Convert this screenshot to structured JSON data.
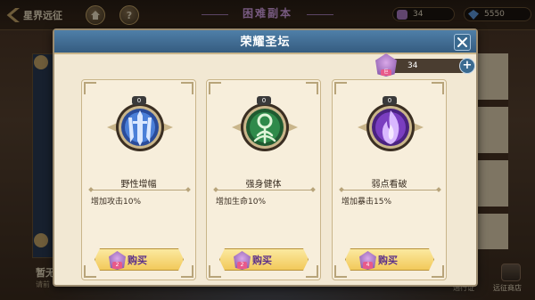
{
  "topbar": {
    "back_label": "星界远征",
    "home_icon": "home-icon",
    "help_label": "?",
    "stage_title": "困难副本",
    "resource_a": "34",
    "resource_b": "5550"
  },
  "background": {
    "bottom_left_title": "暂无",
    "bottom_left_sub": "请前",
    "bottom_mid_label": "通行证",
    "shop_label": "远征商店"
  },
  "modal": {
    "title": "荣耀圣坛",
    "currency_amount": "34",
    "currency_badge": "巨",
    "plus_label": "+"
  },
  "cards": [
    {
      "name": "野性增幅",
      "desc": "增加攻击10%",
      "level": "0",
      "cost": "2",
      "buy_label": "购买",
      "icon": "sword-emblem-icon",
      "accent": "#4a7fd8"
    },
    {
      "name": "强身健体",
      "desc": "增加生命10%",
      "level": "0",
      "cost": "2",
      "buy_label": "购买",
      "icon": "life-emblem-icon",
      "accent": "#2f8a4a"
    },
    {
      "name": "弱点看破",
      "desc": "增加暴击15%",
      "level": "0",
      "cost": "4",
      "buy_label": "购买",
      "icon": "flame-emblem-icon",
      "accent": "#7a3ec0"
    }
  ]
}
